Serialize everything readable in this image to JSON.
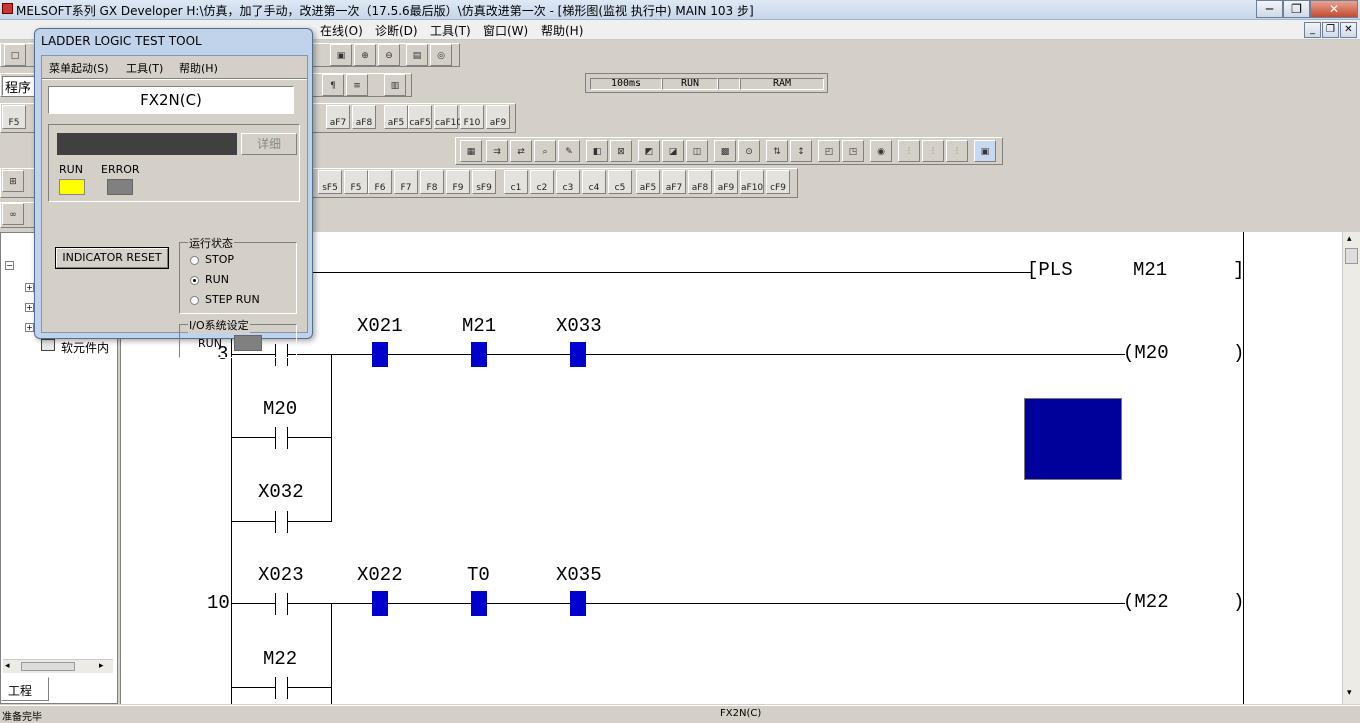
{
  "window": {
    "title": "MELSOFT系列 GX Developer H:\\仿真，加了手动，改进第一次（17.5.6最后版）\\仿真改进第一次 - [梯形图(监视 执行中)     MAIN     103 步]",
    "min": "─",
    "max": "❐",
    "close": "✕"
  },
  "menu": [
    {
      "label": "在线(O)"
    },
    {
      "label": "诊断(D)"
    },
    {
      "label": "工具(T)"
    },
    {
      "label": "窗口(W)"
    },
    {
      "label": "帮助(H)"
    }
  ],
  "toolbar": {
    "program_label": "程序",
    "scan_time": "100ms",
    "run_state": "RUN",
    "memory": "RAM"
  },
  "fkeys_row1": [
    "F5",
    "aF7",
    "aF8",
    "aF5",
    "caF5",
    "caF10",
    "F10",
    "aF9"
  ],
  "fkeys_row2": [
    "sF5",
    "F5",
    "F6",
    "F7",
    "F8",
    "F9",
    "sF9",
    "c1",
    "c2",
    "c3",
    "c4",
    "c5",
    "aF5",
    "aF7",
    "aF8",
    "aF9",
    "aF10",
    "cF9"
  ],
  "project": {
    "tab": "工程",
    "item": "软元件内"
  },
  "status_left": "准备完毕",
  "status_plc": "FX2N(C)",
  "ladder": {
    "rung1": {
      "coil_left": "[PLS",
      "device": "M21",
      "coil_right": "]"
    },
    "rung2": {
      "step": "3",
      "contacts": [
        "X021",
        "M21",
        "X033"
      ],
      "coil": "M20",
      "branch1": "M20",
      "branch2": "X032"
    },
    "rung3": {
      "step": "10",
      "contacts": [
        "X023",
        "X022",
        "T0",
        "X035"
      ],
      "coil": "M22",
      "branch1": "M22"
    }
  },
  "test_tool": {
    "title": "LADDER LOGIC TEST TOOL",
    "menu": [
      "菜单起动(S)",
      "工具(T)",
      "帮助(H)"
    ],
    "plc_type": "FX2N(C)",
    "detail_button": "详细",
    "run_label": "RUN",
    "error_label": "ERROR",
    "run_color": "#ffff00",
    "error_color": "#808080",
    "reset_button": "INDICATOR RESET",
    "state_group": "运行状态",
    "states": [
      "STOP",
      "RUN",
      "STEP RUN"
    ],
    "selected_state": "RUN",
    "io_group": "I/O系统设定",
    "io_run": "RUN"
  }
}
